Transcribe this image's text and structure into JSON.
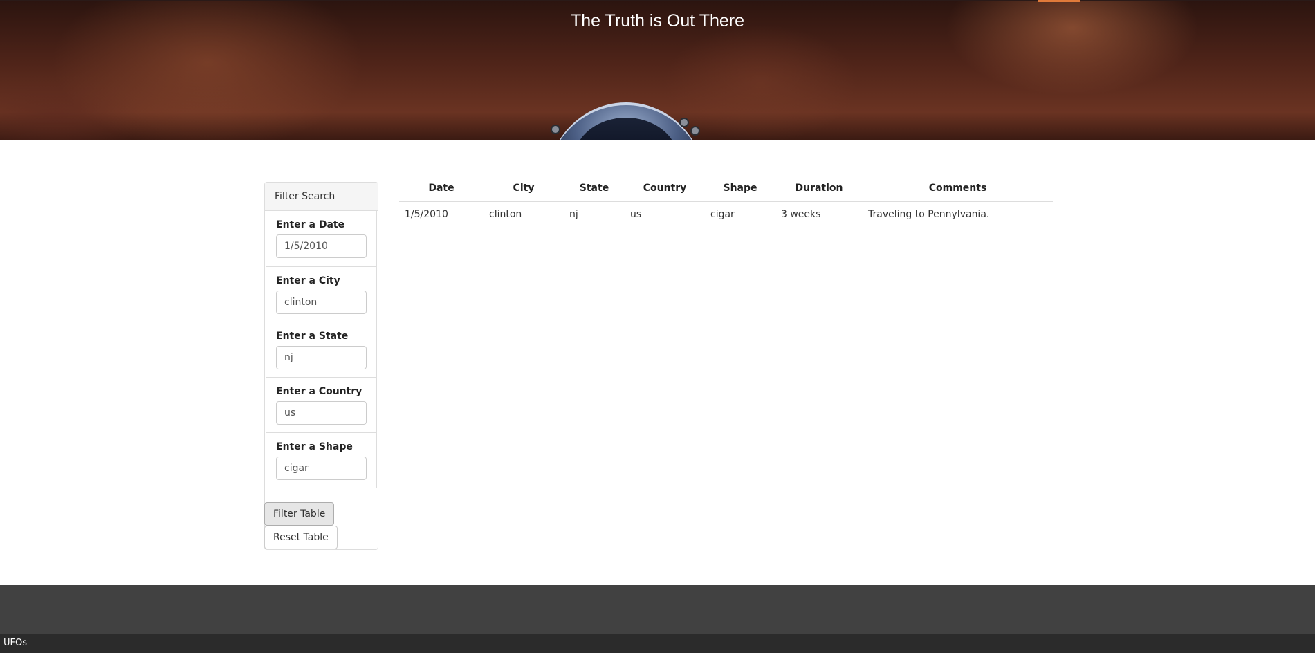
{
  "header": {
    "title": "The Truth is Out There"
  },
  "filter_panel": {
    "heading": "Filter Search",
    "fields": [
      {
        "label": "Enter a Date",
        "value": "1/5/2010"
      },
      {
        "label": "Enter a City",
        "value": "clinton"
      },
      {
        "label": "Enter a State",
        "value": "nj"
      },
      {
        "label": "Enter a Country",
        "value": "us"
      },
      {
        "label": "Enter a Shape",
        "value": "cigar"
      }
    ],
    "filter_button": "Filter Table",
    "reset_button": "Reset Table"
  },
  "table": {
    "columns": [
      "Date",
      "City",
      "State",
      "Country",
      "Shape",
      "Duration",
      "Comments"
    ],
    "rows": [
      [
        "1/5/2010",
        "clinton",
        "nj",
        "us",
        "cigar",
        "3 weeks",
        "Traveling to Pennylvania."
      ]
    ]
  },
  "bottom_bar": {
    "label": "UFOs"
  },
  "colors": {
    "footer": "#414141",
    "bottom_bar": "#2b2b2b",
    "hero": "#4f2419"
  }
}
